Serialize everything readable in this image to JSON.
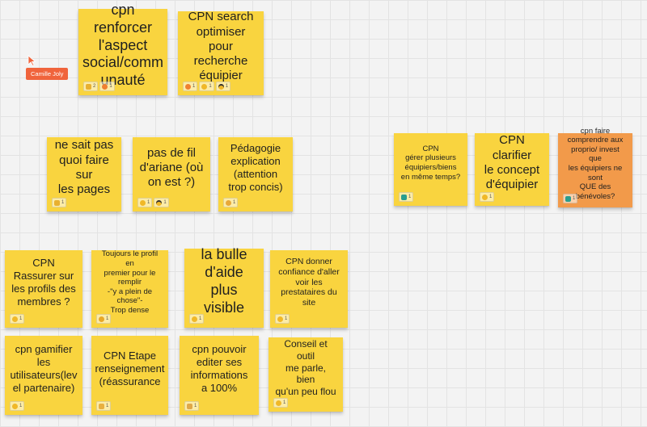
{
  "collaborator": {
    "name": "Camille Joly",
    "color": "#f0643c"
  },
  "notes": [
    {
      "id": "n1",
      "text": "cpn renforcer\nl'aspect\nsocial/comm\nunauté",
      "color": "yellow",
      "reactions": [
        {
          "icon": "thumbs-up-icon",
          "count": "2"
        },
        {
          "icon": "heart-eyes-icon",
          "count": "1"
        }
      ]
    },
    {
      "id": "n2",
      "text": "CPN search\noptimiser pour\nrecherche\néquipier",
      "color": "yellow",
      "reactions": [
        {
          "icon": "heart-eyes-icon",
          "count": "1"
        },
        {
          "icon": "smile-icon",
          "count": "1"
        },
        {
          "icon": "sunglasses-icon",
          "count": "1"
        }
      ]
    },
    {
      "id": "n3",
      "text": "ne sait pas\nquoi faire sur\nles pages",
      "color": "yellow",
      "reactions": [
        {
          "icon": "thumbs-up-icon",
          "count": "1"
        }
      ]
    },
    {
      "id": "n4",
      "text": "pas de fil\nd'ariane (où\non est ?)",
      "color": "yellow",
      "reactions": [
        {
          "icon": "smile-icon",
          "count": "1"
        },
        {
          "icon": "sunglasses-icon",
          "count": "1"
        }
      ]
    },
    {
      "id": "n5",
      "text": "Pédagogie\nexplication\n(attention\ntrop concis)",
      "color": "yellow",
      "reactions": [
        {
          "icon": "thinking-icon",
          "count": "1"
        }
      ]
    },
    {
      "id": "n6",
      "text": "CPN\ngérer plusieurs\néquipiers/biens\nen même temps?",
      "color": "yellow",
      "reactions": [
        {
          "icon": "pointing-icon",
          "count": "1"
        }
      ]
    },
    {
      "id": "n7",
      "text": "CPN clarifier\nle concept\nd'équipier",
      "color": "yellow",
      "reactions": [
        {
          "icon": "smile-icon",
          "count": "1"
        }
      ]
    },
    {
      "id": "n8",
      "text": "cpn faire\ncomprendre aux\nproprio/ invest que\nles équipiers ne sont\nQUE des bénévoles?",
      "color": "orange",
      "reactions": [
        {
          "icon": "pointing-icon",
          "count": "1"
        }
      ]
    },
    {
      "id": "n9",
      "text": "CPN\nRassurer sur\nles profils des\nmembres ?",
      "color": "yellow",
      "reactions": [
        {
          "icon": "smile-icon",
          "count": "1"
        }
      ]
    },
    {
      "id": "n10",
      "text": "Toujours le profil en\npremier pour le\nremplir\n-\"y a plein de\nchose\"-\nTrop dense",
      "color": "yellow",
      "reactions": [
        {
          "icon": "frown-icon",
          "count": "1"
        }
      ]
    },
    {
      "id": "n11",
      "text": "la bulle\nd'aide plus\nvisible",
      "color": "yellow",
      "reactions": [
        {
          "icon": "smile-icon",
          "count": "1"
        }
      ]
    },
    {
      "id": "n12",
      "text": "CPN donner\nconfiance d'aller\nvoir les\nprestataires du\nsite",
      "color": "yellow",
      "reactions": [
        {
          "icon": "smile-icon",
          "count": "1"
        }
      ]
    },
    {
      "id": "n13",
      "text": "cpn gamifier\nles\nutilisateurs(lev\nel partenaire)",
      "color": "yellow",
      "reactions": [
        {
          "icon": "smile-icon",
          "count": "1"
        }
      ]
    },
    {
      "id": "n14",
      "text": "CPN Etape\nrenseignement\n(réassurance",
      "color": "yellow",
      "reactions": [
        {
          "icon": "clap-icon",
          "count": "1"
        }
      ]
    },
    {
      "id": "n15",
      "text": "cpn pouvoir\nediter ses\ninformations\na 100%",
      "color": "yellow",
      "reactions": [
        {
          "icon": "raised-hand-icon",
          "count": "1"
        }
      ]
    },
    {
      "id": "n16",
      "text": "Conseil et outil\nme parle, bien\nqu'un peu flou",
      "color": "yellow",
      "reactions": [
        {
          "icon": "smile-icon",
          "count": "1"
        }
      ]
    }
  ]
}
